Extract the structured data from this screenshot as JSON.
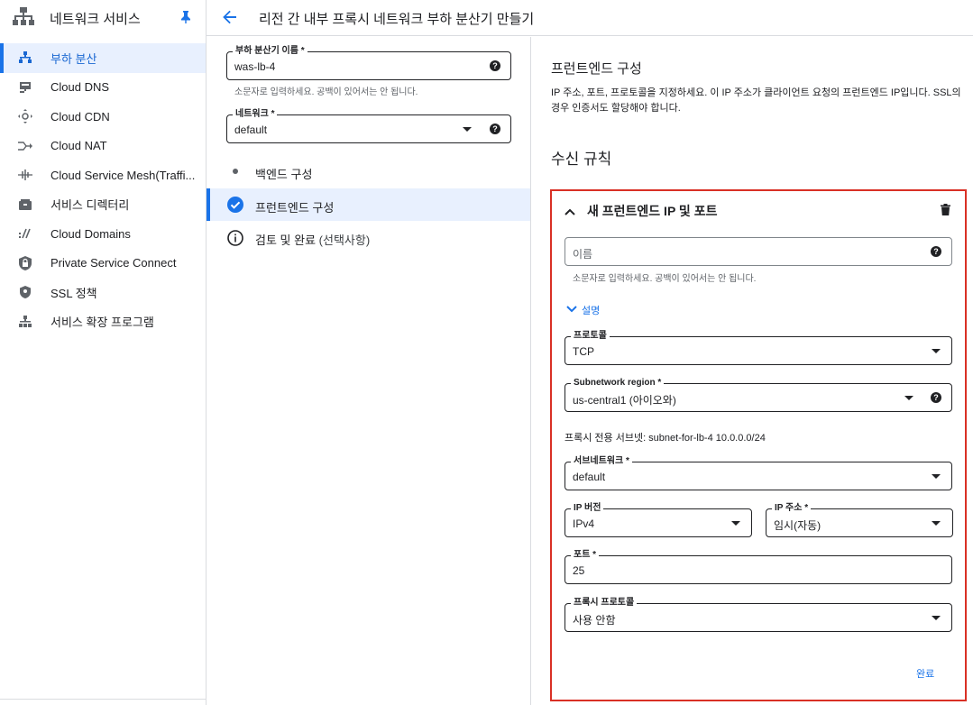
{
  "sidebar": {
    "title": "네트워크 서비스",
    "items": [
      {
        "label": "부하 분산",
        "icon": "load-balancing-icon",
        "active": true
      },
      {
        "label": "Cloud DNS",
        "icon": "cloud-dns-icon"
      },
      {
        "label": "Cloud CDN",
        "icon": "cloud-cdn-icon"
      },
      {
        "label": "Cloud NAT",
        "icon": "cloud-nat-icon"
      },
      {
        "label": "Cloud Service Mesh(Traffi...",
        "icon": "service-mesh-icon"
      },
      {
        "label": "서비스 디렉터리",
        "icon": "service-directory-icon"
      },
      {
        "label": "Cloud Domains",
        "icon": "cloud-domains-icon"
      },
      {
        "label": "Private Service Connect",
        "icon": "private-service-connect-icon"
      },
      {
        "label": "SSL 정책",
        "icon": "ssl-policy-icon"
      },
      {
        "label": "서비스 확장 프로그램",
        "icon": "service-extensions-icon"
      }
    ]
  },
  "header": {
    "title": "리전 간 내부 프록시 네트워크 부하 분산기 만들기"
  },
  "form": {
    "lb_name": {
      "label": "부하 분산기 이름 *",
      "value": "was-lb-4",
      "hint": "소문자로 입력하세요. 공백이 있어서는 안 됩니다."
    },
    "network": {
      "label": "네트워크 *",
      "value": "default"
    }
  },
  "steps": [
    {
      "label": "백엔드 구성",
      "state": "pending"
    },
    {
      "label": "프런트엔드 구성",
      "state": "active"
    },
    {
      "label": "검토 및 완료",
      "suffix": "(선택사항)",
      "state": "info"
    }
  ],
  "frontend": {
    "title": "프런트엔드 구성",
    "description": "IP 주소, 포트, 프로토콜을 지정하세요. 이 IP 주소가 클라이언트 요청의 프런트엔드 IP입니다. SSL의 경우 인증서도 할당해야 합니다.",
    "rules_title": "수신 규칙",
    "panel": {
      "title": "새 프런트엔드 IP 및 포트",
      "name_placeholder": "이름",
      "name_hint": "소문자로 입력하세요. 공백이 있어서는 안 됩니다.",
      "desc_toggle": "설명",
      "protocol": {
        "label": "프로토콜",
        "value": "TCP"
      },
      "region": {
        "label": "Subnetwork region *",
        "value": "us-central1 (아이오와)"
      },
      "proxy_subnet": "프록시 전용 서브넷: subnet-for-lb-4 10.0.0.0/24",
      "subnetwork": {
        "label": "서브네트워크 *",
        "value": "default"
      },
      "ip_version": {
        "label": "IP 버전",
        "value": "IPv4"
      },
      "ip_address": {
        "label": "IP 주소 *",
        "value": "임시(자동)"
      },
      "port": {
        "label": "포트 *",
        "value": "25"
      },
      "proxy_protocol": {
        "label": "프록시 프로토콜",
        "value": "사용 안함"
      },
      "done_label": "완료"
    }
  },
  "colors": {
    "accent": "#1a73e8",
    "active_bg": "#e8f0fe",
    "highlight_border": "#d93025"
  }
}
